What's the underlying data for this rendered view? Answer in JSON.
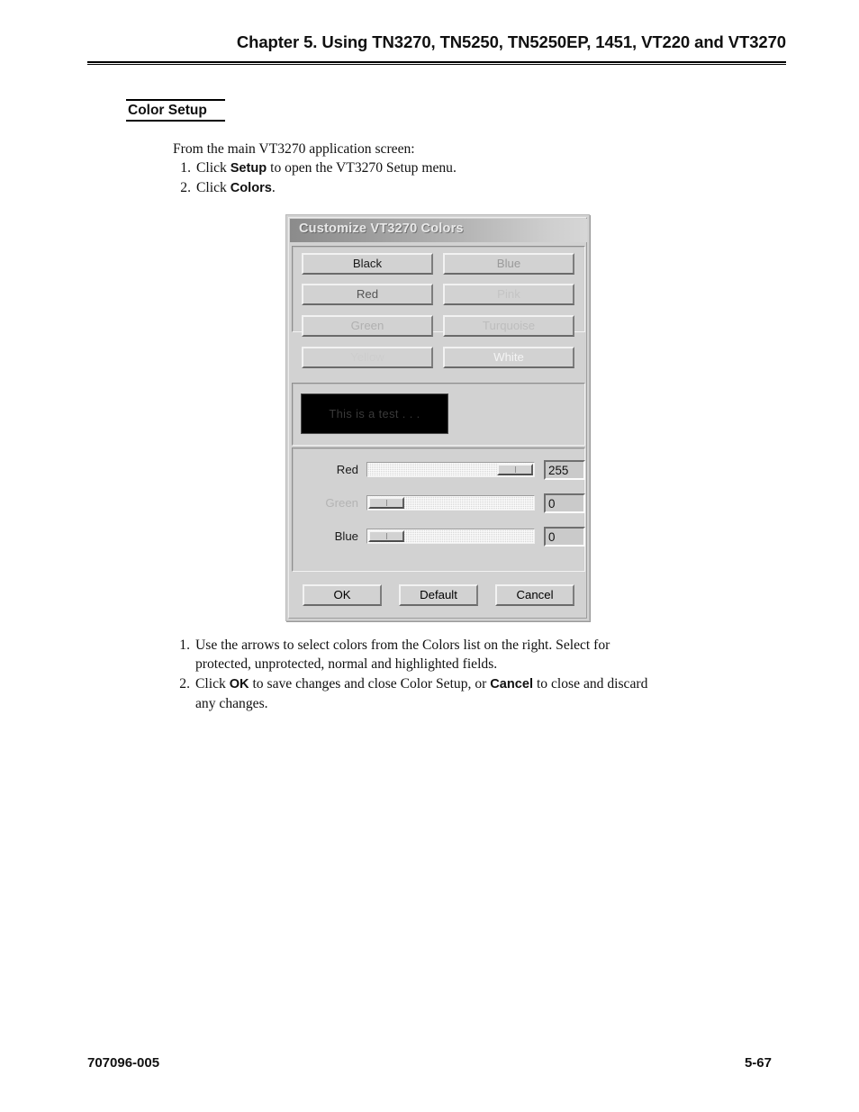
{
  "page": {
    "chapter_heading": "Chapter 5.  Using  TN3270, TN5250, TN5250EP, 1451, VT220 and VT3270",
    "section_heading": "Color Setup",
    "footer_left": "707096-005",
    "footer_right": "5-67"
  },
  "intro": {
    "lead": "From the main VT3270 application screen:",
    "steps": [
      {
        "num": "1.",
        "pre": "Click ",
        "bold": "Setup",
        "post": " to open the VT3270 Setup menu."
      },
      {
        "num": "2.",
        "pre": "Click ",
        "bold": "Colors",
        "post": "."
      }
    ]
  },
  "after": {
    "steps": [
      {
        "num": "1.",
        "line1": "Use the arrows to select colors from the Colors list on the right. Select for",
        "line2": "protected, unprotected, normal and highlighted fields."
      },
      {
        "num": "2.",
        "pre": "Click ",
        "bold1": "OK",
        "mid": " to save changes and close Color Setup, or ",
        "bold2": "Cancel",
        "post": " to close and discard",
        "line2": "any changes."
      }
    ]
  },
  "dialog": {
    "title": "Customize VT3270 Colors",
    "color_buttons": [
      {
        "label": "Black",
        "text_color": "#1a1a1a"
      },
      {
        "label": "Blue",
        "text_color": "#9a9a9a"
      },
      {
        "label": "Red",
        "text_color": "#555555"
      },
      {
        "label": "Pink",
        "text_color": "#c4c4c4"
      },
      {
        "label": "Green",
        "text_color": "#b0b0b0"
      },
      {
        "label": "Turquoise",
        "text_color": "#bdbdbd"
      },
      {
        "label": "Yellow",
        "text_color": "#cdcdcd"
      },
      {
        "label": "White",
        "text_color": "#f4f4f4"
      }
    ],
    "preview": {
      "text": "This is a test . . .",
      "background": "#000000",
      "foreground": "#3a3a3a"
    },
    "sliders": [
      {
        "label": "Red",
        "value": "255",
        "position": "max",
        "label_color": "#1a1a1a"
      },
      {
        "label": "Green",
        "value": "0",
        "position": "min",
        "label_color": "#b4b4b4"
      },
      {
        "label": "Blue",
        "value": "0",
        "position": "min",
        "label_color": "#1a1a1a"
      }
    ],
    "actions": [
      {
        "label": "OK"
      },
      {
        "label": "Default"
      },
      {
        "label": "Cancel"
      }
    ]
  }
}
